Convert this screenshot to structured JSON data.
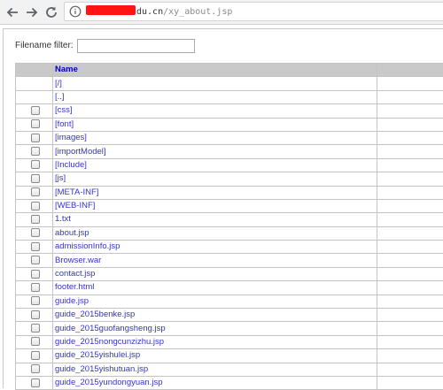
{
  "browser": {
    "url_host": "du.cn",
    "url_path": "/xy_about.jsp"
  },
  "filter": {
    "label": "Filename filter:",
    "value": ""
  },
  "table": {
    "header_name": "Name",
    "rows": [
      {
        "name": "[/]",
        "checkbox": false
      },
      {
        "name": "[..]",
        "checkbox": false
      },
      {
        "name": "[css]",
        "checkbox": true
      },
      {
        "name": "[font]",
        "checkbox": true
      },
      {
        "name": "[images]",
        "checkbox": true
      },
      {
        "name": "[importModel]",
        "checkbox": true
      },
      {
        "name": "[Include]",
        "checkbox": true
      },
      {
        "name": "[js]",
        "checkbox": true
      },
      {
        "name": "[META-INF]",
        "checkbox": true
      },
      {
        "name": "[WEB-INF]",
        "checkbox": true
      },
      {
        "name": "1.txt",
        "checkbox": true
      },
      {
        "name": "about.jsp",
        "checkbox": true
      },
      {
        "name": "admissionInfo.jsp",
        "checkbox": true
      },
      {
        "name": "Browser.war",
        "checkbox": true
      },
      {
        "name": "contact.jsp",
        "checkbox": true
      },
      {
        "name": "footer.html",
        "checkbox": true
      },
      {
        "name": "guide.jsp",
        "checkbox": true
      },
      {
        "name": "guide_2015benke.jsp",
        "checkbox": true
      },
      {
        "name": "guide_2015guofangsheng.jsp",
        "checkbox": true
      },
      {
        "name": "guide_2015nongcunzizhu.jsp",
        "checkbox": true
      },
      {
        "name": "guide_2015yishulei.jsp",
        "checkbox": true
      },
      {
        "name": "guide_2015yishutuan.jsp",
        "checkbox": true
      },
      {
        "name": "guide_2015yundongyuan.jsp",
        "checkbox": true
      }
    ]
  },
  "colors": {
    "link": "#3333cc",
    "header_bg": "#c9c9c9",
    "redaction": "#ff1414"
  }
}
